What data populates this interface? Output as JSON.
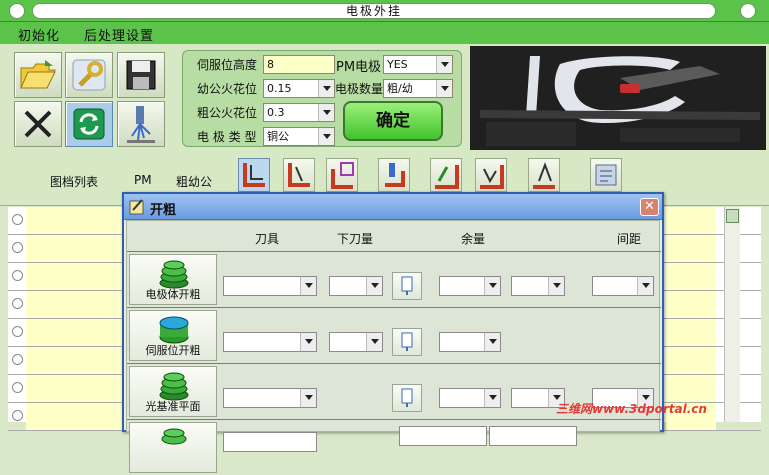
{
  "window": {
    "title": "电极外挂"
  },
  "menu": {
    "items": [
      "初始化",
      "后处理设置"
    ]
  },
  "params": {
    "servo_height_label": "伺服位高度",
    "servo_height_value": "8",
    "fine_spark_label": "幼公火花位",
    "fine_spark_value": "0.15",
    "rough_spark_label": "粗公火花位",
    "rough_spark_value": "0.3",
    "electrode_type_label": "电 极 类 型",
    "electrode_type_value": "铜公",
    "pm_electrode_label": "PM电极",
    "pm_electrode_value": "YES",
    "electrode_count_label": "电极数量",
    "electrode_count_value": "粗/幼",
    "confirm_label": "确定"
  },
  "tabs": {
    "list_label": "图档列表",
    "pm_label": "PM",
    "rough_label": "粗幼公"
  },
  "dialog": {
    "title": "开粗",
    "close_glyph": "✕",
    "columns": {
      "tool": "刀具",
      "down_amount": "下刀量",
      "allowance": "余量",
      "spacing": "间距"
    },
    "rows": [
      {
        "label": "电极体开粗"
      },
      {
        "label": "伺服位开粗"
      },
      {
        "label": "光基准平面"
      },
      {
        "label": ""
      }
    ]
  },
  "watermark": "三维网www.3dportal.cn",
  "colors": {
    "accent_green": "#5bc24a",
    "dialog_title_blue": "#6a9be0",
    "field_yellow": "#ffffc8",
    "watermark_red": "#e43a3a"
  }
}
